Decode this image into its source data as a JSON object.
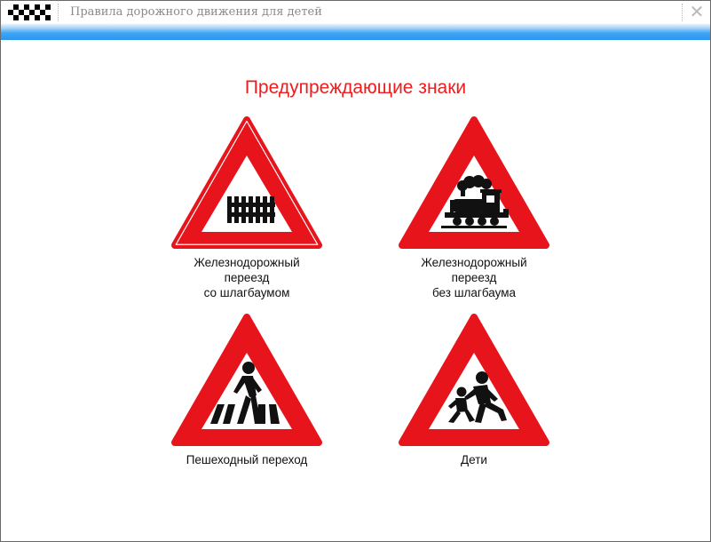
{
  "window": {
    "title": "Правила дорожного движения для детей",
    "close_glyph": "✕",
    "icons": [
      "checkered-logo-icon",
      "close-icon"
    ]
  },
  "page": {
    "heading": "Предупреждающие знаки"
  },
  "colors": {
    "sign_red": "#e8141b",
    "heading_red": "#ee1c1c",
    "sign_white": "#ffffff",
    "symbol_black": "#111111",
    "title_bar_blue": "#2b95ef"
  },
  "signs": [
    {
      "caption": "Железнодорожный\nпереезд\nсо шлагбаумом",
      "icon": "railway-crossing-with-barrier-icon"
    },
    {
      "caption": "Железнодорожный\nпереезд\nбез шлагбаума",
      "icon": "railway-crossing-without-barrier-icon"
    },
    {
      "caption": "Пешеходный переход",
      "icon": "pedestrian-crossing-icon"
    },
    {
      "caption": "Дети",
      "icon": "children-icon"
    }
  ]
}
